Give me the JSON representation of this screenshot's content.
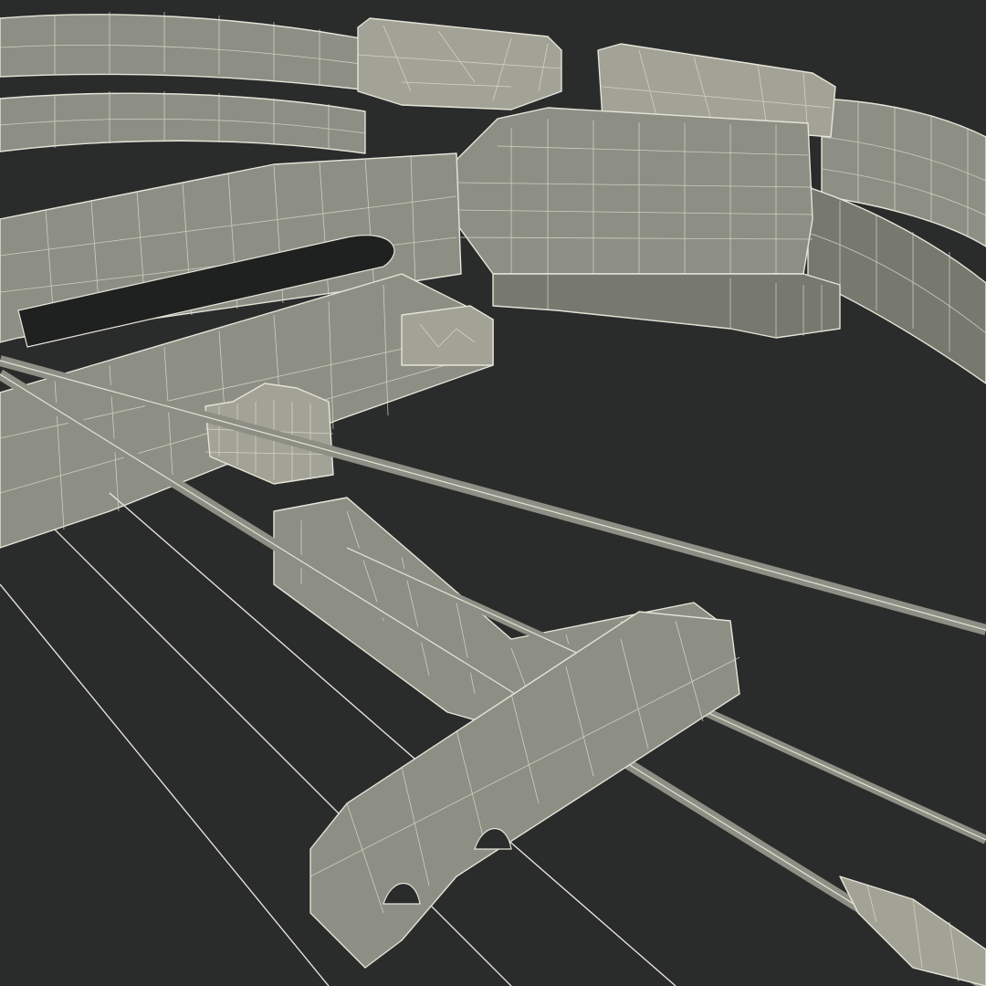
{
  "scene": {
    "subject": "crossbow-wireframe-render",
    "colors": {
      "background": "#2a2b2b",
      "mesh_fill": "#8e8f84",
      "wire": "#e4e4d8"
    }
  }
}
